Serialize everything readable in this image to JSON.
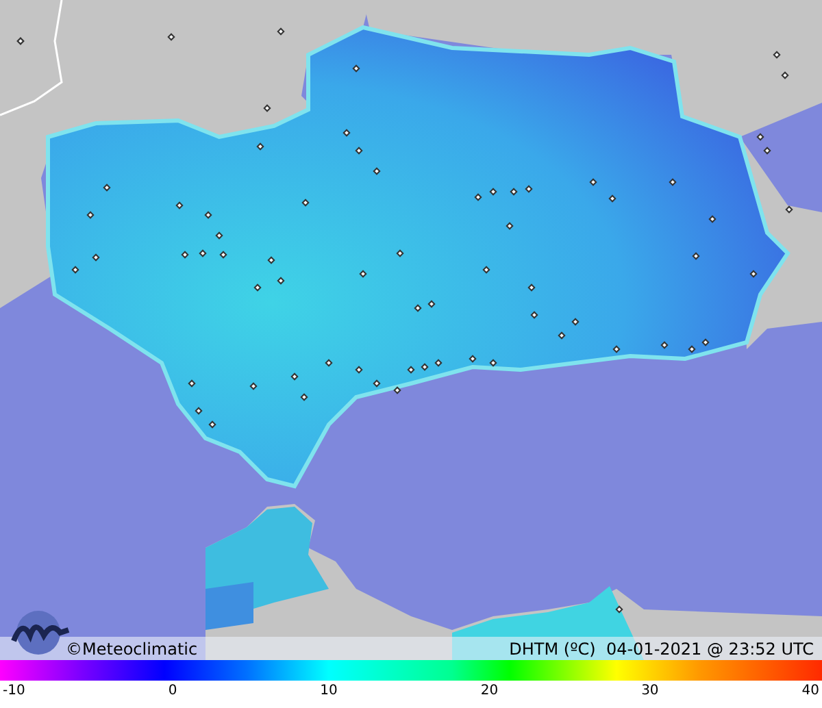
{
  "caption": {
    "brand": "©Meteoclimatic",
    "title": "DHTM (ºC)  04-01-2021 @ 23:52 UTC"
  },
  "legend": {
    "ticks": [
      "-10",
      "0",
      "10",
      "20",
      "30",
      "40"
    ]
  }
}
